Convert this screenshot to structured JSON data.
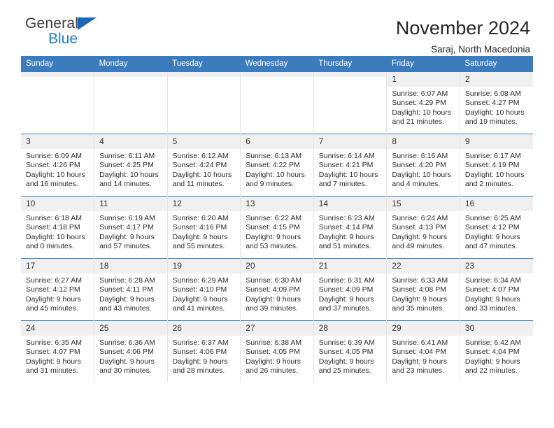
{
  "brand": {
    "name_part1": "General",
    "name_part2": "Blue",
    "mark": "triangle-logo",
    "accent_color": "#1b7fd4"
  },
  "header": {
    "title": "November 2024",
    "location": "Saraj, North Macedonia"
  },
  "theme": {
    "header_row_bg": "#3a7cbe",
    "daynum_bg": "#f0f0f0",
    "cell_bg": "#ffffff",
    "grid_line": "#3a7cbe"
  },
  "calendar": {
    "weekday_headers": [
      "Sunday",
      "Monday",
      "Tuesday",
      "Wednesday",
      "Thursday",
      "Friday",
      "Saturday"
    ],
    "weeks": [
      [
        {
          "day": "",
          "blank": true,
          "sunrise": "",
          "sunset": "",
          "daylight_line1": "",
          "daylight_line2": ""
        },
        {
          "day": "",
          "blank": true,
          "sunrise": "",
          "sunset": "",
          "daylight_line1": "",
          "daylight_line2": ""
        },
        {
          "day": "",
          "blank": true,
          "sunrise": "",
          "sunset": "",
          "daylight_line1": "",
          "daylight_line2": ""
        },
        {
          "day": "",
          "blank": true,
          "sunrise": "",
          "sunset": "",
          "daylight_line1": "",
          "daylight_line2": ""
        },
        {
          "day": "",
          "blank": true,
          "sunrise": "",
          "sunset": "",
          "daylight_line1": "",
          "daylight_line2": ""
        },
        {
          "day": "1",
          "blank": false,
          "sunrise": "Sunrise: 6:07 AM",
          "sunset": "Sunset: 4:29 PM",
          "daylight_line1": "Daylight: 10 hours",
          "daylight_line2": "and 21 minutes."
        },
        {
          "day": "2",
          "blank": false,
          "sunrise": "Sunrise: 6:08 AM",
          "sunset": "Sunset: 4:27 PM",
          "daylight_line1": "Daylight: 10 hours",
          "daylight_line2": "and 19 minutes."
        }
      ],
      [
        {
          "day": "3",
          "blank": false,
          "sunrise": "Sunrise: 6:09 AM",
          "sunset": "Sunset: 4:26 PM",
          "daylight_line1": "Daylight: 10 hours",
          "daylight_line2": "and 16 minutes."
        },
        {
          "day": "4",
          "blank": false,
          "sunrise": "Sunrise: 6:11 AM",
          "sunset": "Sunset: 4:25 PM",
          "daylight_line1": "Daylight: 10 hours",
          "daylight_line2": "and 14 minutes."
        },
        {
          "day": "5",
          "blank": false,
          "sunrise": "Sunrise: 6:12 AM",
          "sunset": "Sunset: 4:24 PM",
          "daylight_line1": "Daylight: 10 hours",
          "daylight_line2": "and 11 minutes."
        },
        {
          "day": "6",
          "blank": false,
          "sunrise": "Sunrise: 6:13 AM",
          "sunset": "Sunset: 4:22 PM",
          "daylight_line1": "Daylight: 10 hours",
          "daylight_line2": "and 9 minutes."
        },
        {
          "day": "7",
          "blank": false,
          "sunrise": "Sunrise: 6:14 AM",
          "sunset": "Sunset: 4:21 PM",
          "daylight_line1": "Daylight: 10 hours",
          "daylight_line2": "and 7 minutes."
        },
        {
          "day": "8",
          "blank": false,
          "sunrise": "Sunrise: 6:16 AM",
          "sunset": "Sunset: 4:20 PM",
          "daylight_line1": "Daylight: 10 hours",
          "daylight_line2": "and 4 minutes."
        },
        {
          "day": "9",
          "blank": false,
          "sunrise": "Sunrise: 6:17 AM",
          "sunset": "Sunset: 4:19 PM",
          "daylight_line1": "Daylight: 10 hours",
          "daylight_line2": "and 2 minutes."
        }
      ],
      [
        {
          "day": "10",
          "blank": false,
          "sunrise": "Sunrise: 6:18 AM",
          "sunset": "Sunset: 4:18 PM",
          "daylight_line1": "Daylight: 10 hours",
          "daylight_line2": "and 0 minutes."
        },
        {
          "day": "11",
          "blank": false,
          "sunrise": "Sunrise: 6:19 AM",
          "sunset": "Sunset: 4:17 PM",
          "daylight_line1": "Daylight: 9 hours",
          "daylight_line2": "and 57 minutes."
        },
        {
          "day": "12",
          "blank": false,
          "sunrise": "Sunrise: 6:20 AM",
          "sunset": "Sunset: 4:16 PM",
          "daylight_line1": "Daylight: 9 hours",
          "daylight_line2": "and 55 minutes."
        },
        {
          "day": "13",
          "blank": false,
          "sunrise": "Sunrise: 6:22 AM",
          "sunset": "Sunset: 4:15 PM",
          "daylight_line1": "Daylight: 9 hours",
          "daylight_line2": "and 53 minutes."
        },
        {
          "day": "14",
          "blank": false,
          "sunrise": "Sunrise: 6:23 AM",
          "sunset": "Sunset: 4:14 PM",
          "daylight_line1": "Daylight: 9 hours",
          "daylight_line2": "and 51 minutes."
        },
        {
          "day": "15",
          "blank": false,
          "sunrise": "Sunrise: 6:24 AM",
          "sunset": "Sunset: 4:13 PM",
          "daylight_line1": "Daylight: 9 hours",
          "daylight_line2": "and 49 minutes."
        },
        {
          "day": "16",
          "blank": false,
          "sunrise": "Sunrise: 6:25 AM",
          "sunset": "Sunset: 4:12 PM",
          "daylight_line1": "Daylight: 9 hours",
          "daylight_line2": "and 47 minutes."
        }
      ],
      [
        {
          "day": "17",
          "blank": false,
          "sunrise": "Sunrise: 6:27 AM",
          "sunset": "Sunset: 4:12 PM",
          "daylight_line1": "Daylight: 9 hours",
          "daylight_line2": "and 45 minutes."
        },
        {
          "day": "18",
          "blank": false,
          "sunrise": "Sunrise: 6:28 AM",
          "sunset": "Sunset: 4:11 PM",
          "daylight_line1": "Daylight: 9 hours",
          "daylight_line2": "and 43 minutes."
        },
        {
          "day": "19",
          "blank": false,
          "sunrise": "Sunrise: 6:29 AM",
          "sunset": "Sunset: 4:10 PM",
          "daylight_line1": "Daylight: 9 hours",
          "daylight_line2": "and 41 minutes."
        },
        {
          "day": "20",
          "blank": false,
          "sunrise": "Sunrise: 6:30 AM",
          "sunset": "Sunset: 4:09 PM",
          "daylight_line1": "Daylight: 9 hours",
          "daylight_line2": "and 39 minutes."
        },
        {
          "day": "21",
          "blank": false,
          "sunrise": "Sunrise: 6:31 AM",
          "sunset": "Sunset: 4:09 PM",
          "daylight_line1": "Daylight: 9 hours",
          "daylight_line2": "and 37 minutes."
        },
        {
          "day": "22",
          "blank": false,
          "sunrise": "Sunrise: 6:33 AM",
          "sunset": "Sunset: 4:08 PM",
          "daylight_line1": "Daylight: 9 hours",
          "daylight_line2": "and 35 minutes."
        },
        {
          "day": "23",
          "blank": false,
          "sunrise": "Sunrise: 6:34 AM",
          "sunset": "Sunset: 4:07 PM",
          "daylight_line1": "Daylight: 9 hours",
          "daylight_line2": "and 33 minutes."
        }
      ],
      [
        {
          "day": "24",
          "blank": false,
          "sunrise": "Sunrise: 6:35 AM",
          "sunset": "Sunset: 4:07 PM",
          "daylight_line1": "Daylight: 9 hours",
          "daylight_line2": "and 31 minutes."
        },
        {
          "day": "25",
          "blank": false,
          "sunrise": "Sunrise: 6:36 AM",
          "sunset": "Sunset: 4:06 PM",
          "daylight_line1": "Daylight: 9 hours",
          "daylight_line2": "and 30 minutes."
        },
        {
          "day": "26",
          "blank": false,
          "sunrise": "Sunrise: 6:37 AM",
          "sunset": "Sunset: 4:06 PM",
          "daylight_line1": "Daylight: 9 hours",
          "daylight_line2": "and 28 minutes."
        },
        {
          "day": "27",
          "blank": false,
          "sunrise": "Sunrise: 6:38 AM",
          "sunset": "Sunset: 4:05 PM",
          "daylight_line1": "Daylight: 9 hours",
          "daylight_line2": "and 26 minutes."
        },
        {
          "day": "28",
          "blank": false,
          "sunrise": "Sunrise: 6:39 AM",
          "sunset": "Sunset: 4:05 PM",
          "daylight_line1": "Daylight: 9 hours",
          "daylight_line2": "and 25 minutes."
        },
        {
          "day": "29",
          "blank": false,
          "sunrise": "Sunrise: 6:41 AM",
          "sunset": "Sunset: 4:04 PM",
          "daylight_line1": "Daylight: 9 hours",
          "daylight_line2": "and 23 minutes."
        },
        {
          "day": "30",
          "blank": false,
          "sunrise": "Sunrise: 6:42 AM",
          "sunset": "Sunset: 4:04 PM",
          "daylight_line1": "Daylight: 9 hours",
          "daylight_line2": "and 22 minutes."
        }
      ]
    ]
  }
}
